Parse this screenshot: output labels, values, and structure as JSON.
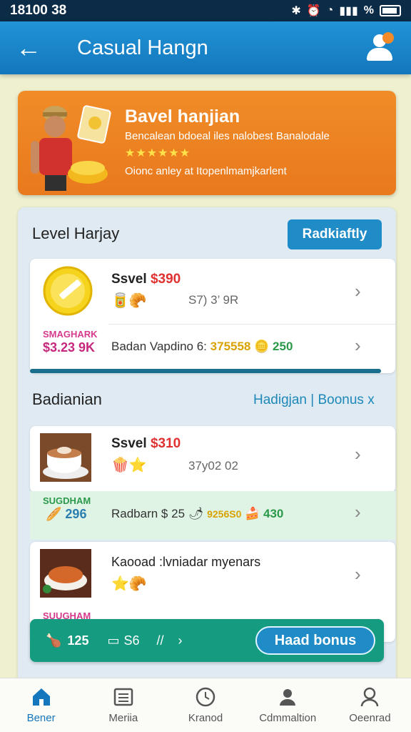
{
  "status_bar": {
    "time": "18100 38",
    "battery_text": "%"
  },
  "app_bar": {
    "title": "Casual Hangn"
  },
  "banner": {
    "title": "Bavel hanjian",
    "subtitle": "Bencalean bdoeal iles nalobest Banalodale",
    "stars": "★★★★★★",
    "note": "Oionc anley at Itopenlmamjkarlent"
  },
  "level_section": {
    "title": "Level Harjay",
    "action_label": "Radkiaftly",
    "item1": {
      "title": "Ssvel",
      "price": "$390",
      "sub": "S7) 3’ 9R"
    },
    "item2": {
      "tag_line1": "SMAGHARK",
      "tag_line2": "$3.23 9K",
      "text": "Badan Vapdino 6:",
      "value1": "375558",
      "value2": "250"
    }
  },
  "badian_section": {
    "title": "Badianian",
    "tabs_link": "Hadigjan | Boonus x",
    "item1": {
      "title": "Ssvel",
      "price": "$310",
      "sub": "37y02 02"
    },
    "item2": {
      "tag": "SUGDHAM",
      "value": "296",
      "text": "Radbarn $ 25",
      "value_a": "9256S0",
      "value_b": "430"
    },
    "item3": {
      "title": "Kaooad :lvniadar myenars",
      "tag": "SUUGHAM"
    }
  },
  "bonus_bar": {
    "count_a": "125",
    "count_b": "S6",
    "sep": "//",
    "chevron": "›",
    "button_label": "Haad bonus"
  },
  "bottom_nav": {
    "items": [
      {
        "label": "Bener"
      },
      {
        "label": "Meriia"
      },
      {
        "label": "Kranod"
      },
      {
        "label": "Cdmmaltion"
      },
      {
        "label": "Oeenrad"
      }
    ]
  },
  "colors": {
    "app_bar": "#1a86c9",
    "banner": "#ee8526",
    "bonus_bar": "#159b80",
    "accent_red": "#e03030"
  }
}
